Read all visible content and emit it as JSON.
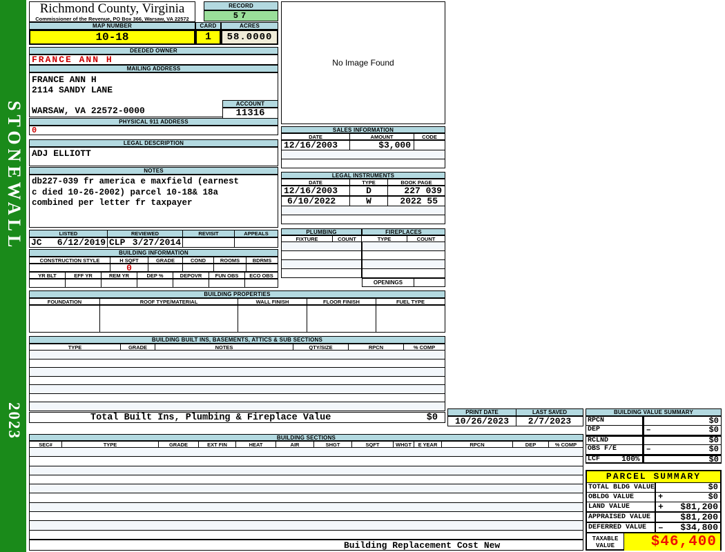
{
  "colors": {
    "sidebar_green": "#1a8a1a",
    "header_blue": "#b3d9e0",
    "record_green": "#9ade9a",
    "highlight_yellow": "#ffff00",
    "cream": "#f0ecd8",
    "alert_red": "#cc0000",
    "taxable_red": "#ee1100",
    "row_alt": "#f3f7fb"
  },
  "sidebar": {
    "district": "STONEWALL",
    "year": "2023"
  },
  "county": {
    "title": "Richmond County, Virginia",
    "subtitle": "Commissioner of the Revenue, PO Box 366, Warsaw, VA 22572"
  },
  "record": {
    "label": "RECORD",
    "value": "57"
  },
  "map": {
    "label": "MAP NUMBER",
    "value": "10-18"
  },
  "cardno": {
    "label": "CARD",
    "value": "1"
  },
  "acres": {
    "label": "ACRES",
    "value": "58.0000"
  },
  "deeded_owner": {
    "label": "DEEDED OWNER",
    "value": "FRANCE ANN H"
  },
  "mailing": {
    "label": "MAILING ADDRESS",
    "line1": "FRANCE ANN H",
    "line2": "2114 SANDY LANE",
    "line3": "",
    "line4": "WARSAW, VA 22572-0000"
  },
  "account": {
    "label": "ACCOUNT",
    "value": "11316"
  },
  "physical911": {
    "label": "PHYSICAL 911 ADDRESS",
    "value": "0"
  },
  "legal_description": {
    "label": "LEGAL DESCRIPTION",
    "value": "ADJ ELLIOTT"
  },
  "notes": {
    "label": "NOTES",
    "line1": "db227-039 fr america e maxfield (earnest",
    "line2": "c died 10-26-2002) parcel 10-18& 18a",
    "line3": "combined per letter fr taxpayer"
  },
  "review": {
    "headers": [
      "LISTED",
      "REVIEWED",
      "REVISIT",
      "APPEALS"
    ],
    "listed_by": "JC",
    "listed_date": "6/12/2019",
    "reviewed_by": "CLP",
    "reviewed_date": "3/27/2014",
    "revisit": "",
    "appeals": ""
  },
  "image_box": {
    "text": "No Image Found"
  },
  "sales": {
    "title": "SALES INFORMATION",
    "headers": [
      "DATE",
      "AMOUNT",
      "CODE"
    ],
    "rows": [
      {
        "date": "12/16/2003",
        "amount": "$3,000",
        "code": ""
      }
    ]
  },
  "legal_instruments": {
    "title": "LEGAL INSTRUMENTS",
    "headers": [
      "DATE",
      "TYPE",
      "BOOK PAGE"
    ],
    "rows": [
      {
        "date": "12/16/2003",
        "type": "D",
        "book_page": "227 039"
      },
      {
        "date": "6/10/2022",
        "type": "W",
        "book_page": "2022 55"
      }
    ]
  },
  "plumbing": {
    "title": "PLUMBING",
    "headers": [
      "FIXTURE",
      "COUNT"
    ]
  },
  "fireplaces": {
    "title": "FIREPLACES",
    "headers": [
      "TYPE",
      "COUNT"
    ],
    "openings_label": "OPENINGS"
  },
  "building_information": {
    "title": "BUILDING INFORMATION",
    "headers_row1": [
      "CONSTRUCTION STYLE",
      "H SQFT",
      "GRADE",
      "COND",
      "ROOMS",
      "BDRMS"
    ],
    "hsqft_value": "0",
    "headers_row2": [
      "YR BLT",
      "EFF YR",
      "REM YR",
      "DEP %",
      "DEPOVR",
      "FUN OBS",
      "ECO OBS"
    ]
  },
  "building_properties": {
    "title": "BUILDING PROPERTIES",
    "headers": [
      "FOUNDATION",
      "ROOF TYPE/MATERIAL",
      "WALL FINISH",
      "FLOOR FINISH",
      "FUEL TYPE"
    ]
  },
  "built_ins": {
    "title": "BUILDING BUILT INS, BASEMENTS, ATTICS & SUB SECTIONS",
    "headers": [
      "TYPE",
      "GRADE",
      "NOTES",
      "QTY/SIZE",
      "RPCN",
      "% COMP"
    ],
    "total_label": "Total Built Ins, Plumbing & Fireplace Value",
    "total_value": "$0"
  },
  "print_date": {
    "label": "PRINT DATE",
    "value": "10/26/2023"
  },
  "last_saved": {
    "label": "LAST SAVED",
    "value": "2/7/2023"
  },
  "building_sections": {
    "title": "BUILDING SECTIONS",
    "headers": [
      "SEC#",
      "TYPE",
      "GRADE",
      "EXT FIN",
      "HEAT",
      "AIR",
      "SHGT",
      "SQFT",
      "WHGT",
      "E YEAR",
      "RPCN",
      "DEP",
      "% COMP"
    ],
    "footer": "Building Replacement Cost New"
  },
  "building_value_summary": {
    "title": "BUILDING VALUE SUMMARY",
    "rows": [
      {
        "label": "RPCN",
        "pct": "",
        "op": "",
        "value": "$0"
      },
      {
        "label": "DEP",
        "pct": "",
        "op": "–",
        "value": "$0"
      },
      {
        "label": "RCLND",
        "pct": "",
        "op": "",
        "value": "$0"
      },
      {
        "label": "OBS F/E",
        "pct": "",
        "op": "–",
        "value": "$0"
      },
      {
        "label": "LCF",
        "pct": "100%",
        "op": "",
        "value": "$0"
      }
    ]
  },
  "parcel_summary": {
    "title": "PARCEL SUMMARY",
    "rows": [
      {
        "label": "TOTAL BLDG VALUE",
        "op": "",
        "value": "$0"
      },
      {
        "label": "OBLDG VALUE",
        "op": "+",
        "value": "$0"
      },
      {
        "label": "LAND VALUE",
        "op": "+",
        "value": "$81,200"
      },
      {
        "label": "APPRAISED VALUE",
        "op": "",
        "value": "$81,200"
      },
      {
        "label": "DEFERRED VALUE",
        "op": "–",
        "value": "$34,800"
      }
    ],
    "taxable_label_1": "TAXABLE",
    "taxable_label_2": "VALUE",
    "taxable_value": "$46,400"
  }
}
